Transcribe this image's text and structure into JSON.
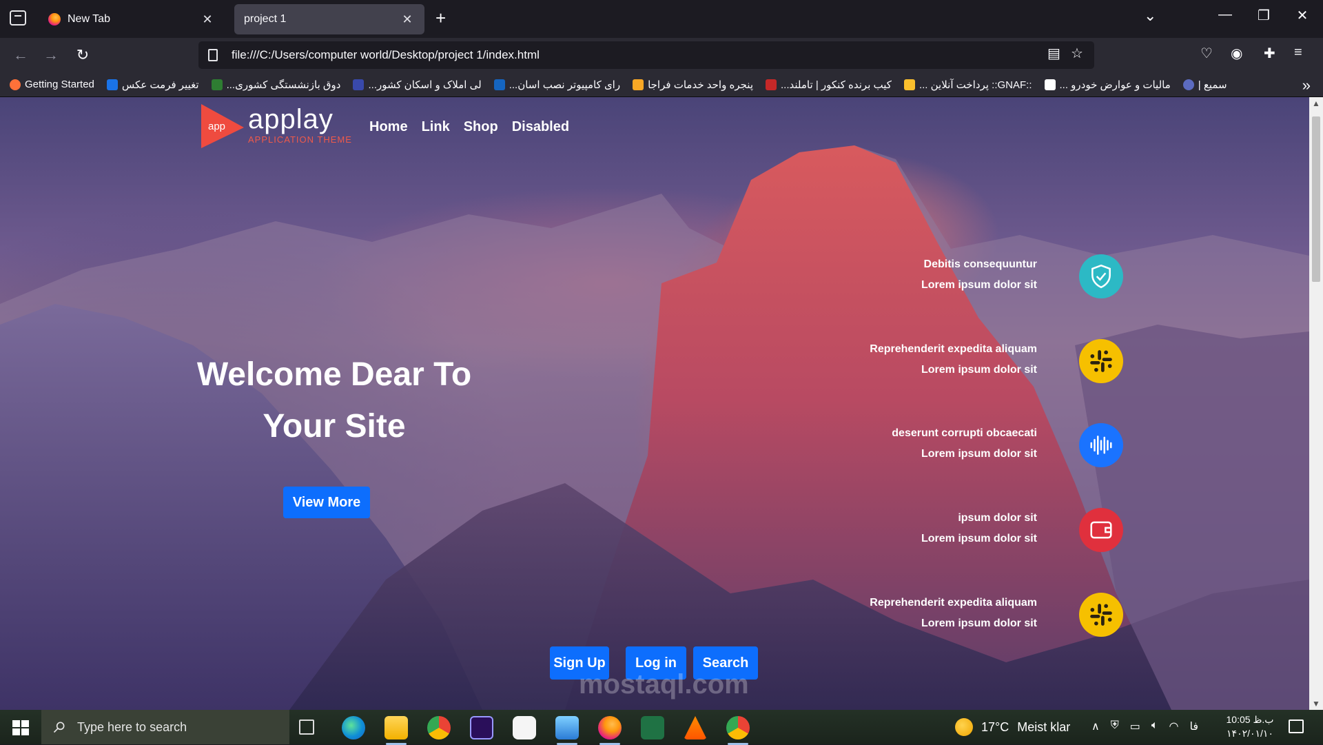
{
  "browser": {
    "tabs": [
      {
        "label": "New Tab",
        "active": false
      },
      {
        "label": "project 1",
        "active": true
      }
    ],
    "url": "file:///C:/Users/computer world/Desktop/project 1/index.html",
    "bookmarks": [
      {
        "label": "Getting Started",
        "color": "#ff7139"
      },
      {
        "label": "تغییر فرمت عکس",
        "color": "#1a73e8"
      },
      {
        "label": "...دوق بازنشستگی کشوری",
        "color": "#2e7d32"
      },
      {
        "label": "...لی املاک و اسکان کشور",
        "color": "#3949ab"
      },
      {
        "label": "...رای کامپیوتر نصب اسان",
        "color": "#1565c0"
      },
      {
        "label": "پنجره واحد خدمات فراجا",
        "color": "#f9a825"
      },
      {
        "label": "...کیب برنده کنکور | تاملند",
        "color": "#c62828"
      },
      {
        "label": "... پرداخت آنلاین ::GNAF::",
        "color": "#fbc02d"
      },
      {
        "label": "... مالیات و عوارض خودرو",
        "color": "#ffffff"
      },
      {
        "label": "| سمیع",
        "color": "#5c6bc0"
      }
    ]
  },
  "site": {
    "logo": {
      "mark_text": "app",
      "name": "applay",
      "subtitle": "APPLICATION THEME",
      "accent": "#ef4b3f"
    },
    "nav": [
      "Home",
      "Link",
      "Shop",
      "Disabled"
    ],
    "hero": {
      "title_line1": "Welcome Dear To",
      "title_line2": "Your Site",
      "cta": "View More"
    },
    "features": [
      {
        "title": "Debitis consequuntur",
        "subtitle": "Lorem ipsum dolor sit",
        "icon": "shield-check-icon",
        "color": "#2cb9c5"
      },
      {
        "title": "Reprehenderit expedita aliquam",
        "subtitle": "Lorem ipsum dolor sit",
        "icon": "slack-icon",
        "color": "#f6c000"
      },
      {
        "title": "deserunt corrupti obcaecati",
        "subtitle": "Lorem ipsum dolor sit",
        "icon": "soundwave-icon",
        "color": "#1a73ff"
      },
      {
        "title": "ipsum dolor sit",
        "subtitle": "Lorem ipsum dolor sit",
        "icon": "wallet-icon",
        "color": "#e0303d"
      },
      {
        "title": "Reprehenderit expedita aliquam",
        "subtitle": "Lorem ipsum dolor sit",
        "icon": "slack-icon",
        "color": "#f6c000"
      }
    ],
    "buttons": [
      "Sign Up",
      "Log in",
      "Search"
    ],
    "primary_color": "#0d6efd"
  },
  "watermark": "mostaql.com",
  "taskbar": {
    "search_placeholder": "Type here to search",
    "weather": {
      "temp": "17°C",
      "desc": "Meist klar"
    },
    "lang": "فا",
    "time": "10:05 ب.ظ",
    "date": "۱۴۰۲/۰۱/۱۰"
  }
}
